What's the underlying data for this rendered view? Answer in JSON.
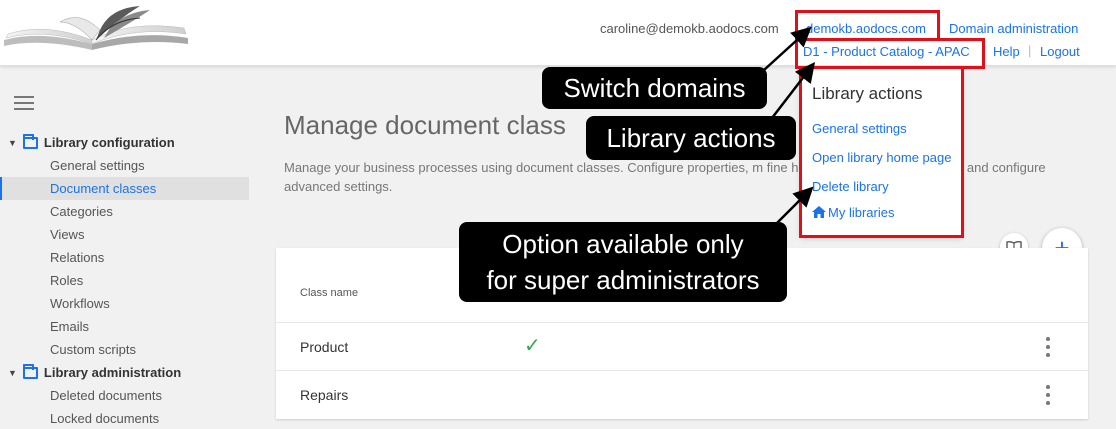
{
  "header": {
    "user_email": "caroline@demokb.aodocs.com",
    "domain_link": "demokb.aodocs.com",
    "domain_admin": "Domain administration",
    "library_link": "D1 - Product Catalog - APAC",
    "help": "Help",
    "separator": "|",
    "logout": "Logout"
  },
  "sidebar": {
    "sections": [
      {
        "title": "Library configuration",
        "items": [
          "General settings",
          "Document classes",
          "Categories",
          "Views",
          "Relations",
          "Roles",
          "Workflows",
          "Emails",
          "Custom scripts"
        ]
      },
      {
        "title": "Library administration",
        "items": [
          "Deleted documents",
          "Locked documents"
        ]
      }
    ],
    "active_item": "Document classes"
  },
  "main": {
    "title": "Manage document class",
    "description": "Manage your business processes using document classes. Configure properties, m                                                  fine how documents are displayed and configure advanced settings.",
    "table": {
      "column_header": "Class name",
      "rows": [
        {
          "name": "Product",
          "has_check": true
        },
        {
          "name": "Repairs",
          "has_check": false
        }
      ]
    }
  },
  "menu": {
    "title": "Library actions",
    "items": [
      "General settings",
      "Open library home page",
      "Delete library",
      "My libraries"
    ]
  },
  "callouts": {
    "switch_domains": "Switch domains",
    "library_actions": "Library actions",
    "option_line1": "Option available only",
    "option_line2": "for super administrators"
  },
  "colors": {
    "accent": "#1a73e8",
    "highlight": "#e0101a",
    "check": "#34a853"
  }
}
